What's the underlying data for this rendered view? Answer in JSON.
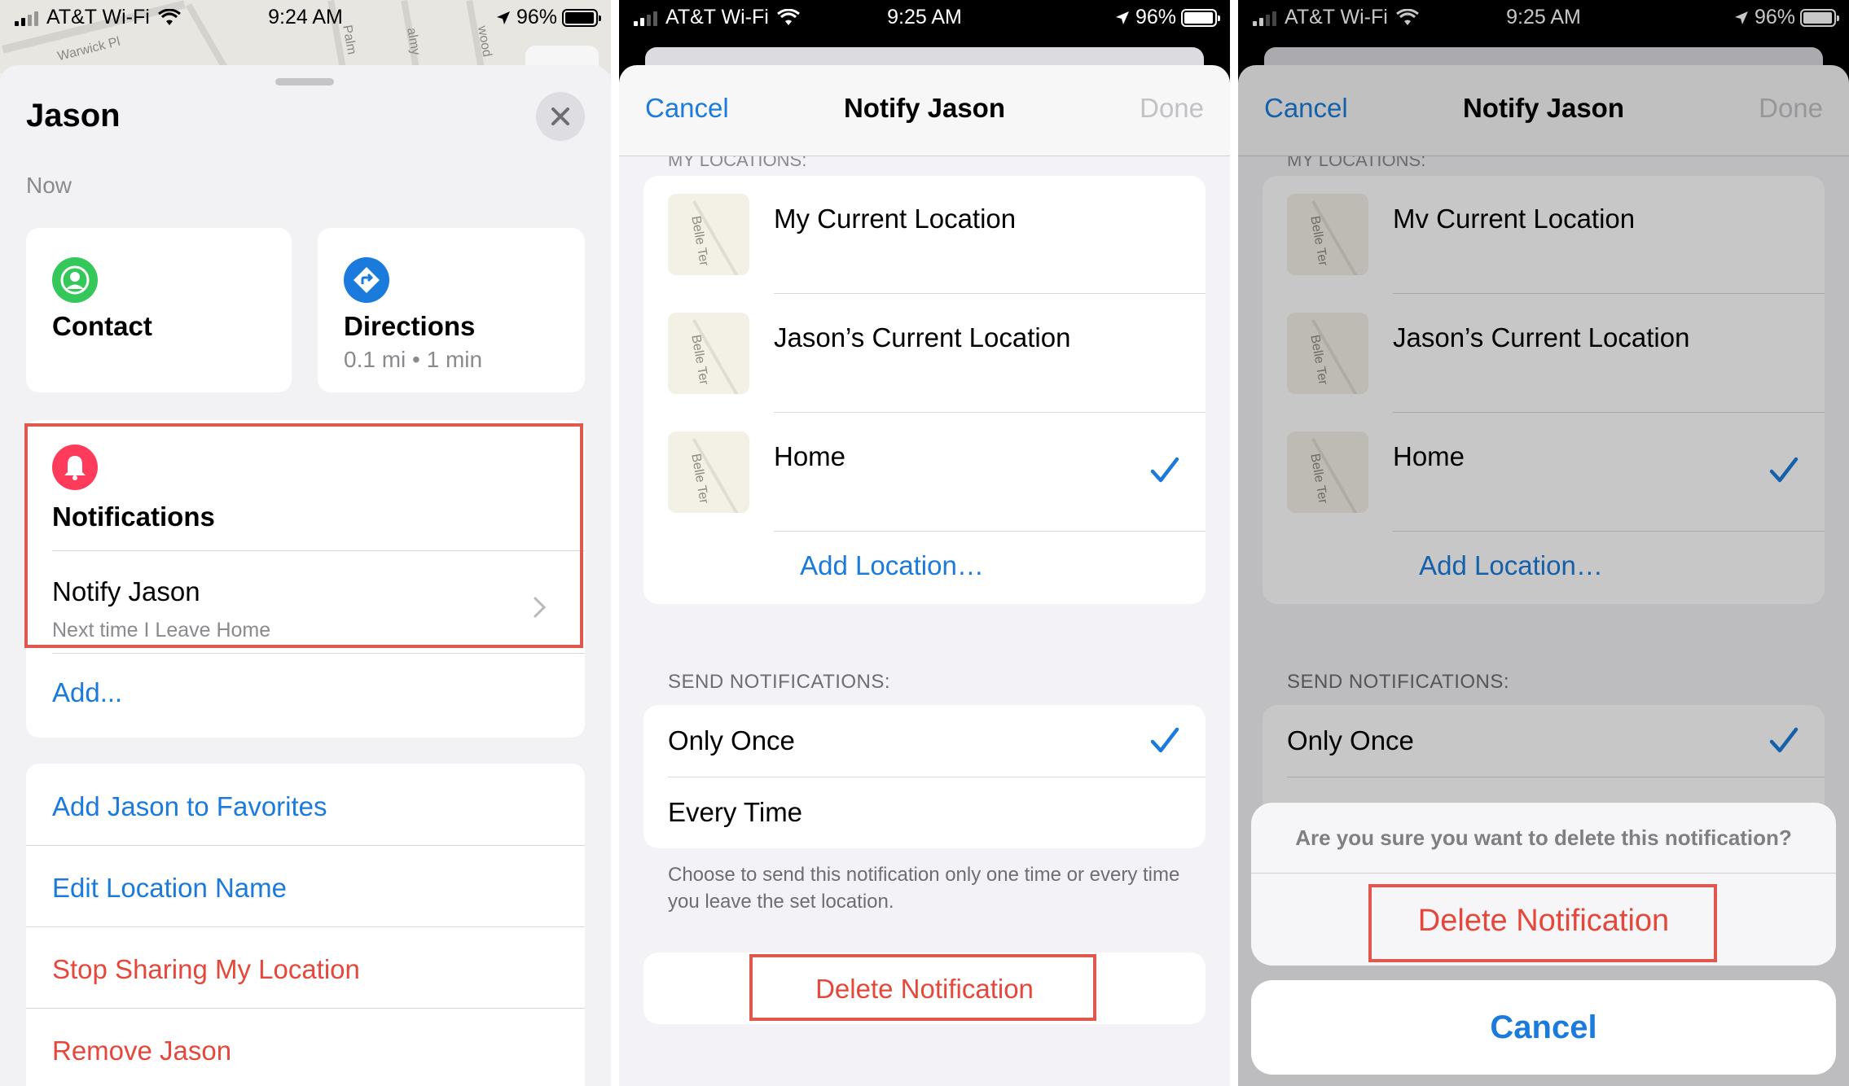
{
  "status_bar": {
    "carrier": "AT&T Wi-Fi",
    "time_panel1": "9:24 AM",
    "time_panel2": "9:25 AM",
    "time_panel3": "9:25 AM",
    "battery": "96%"
  },
  "map_labels": [
    "Warwick Pl",
    "Palm",
    "almy",
    "wood"
  ],
  "person_sheet": {
    "name": "Jason",
    "time": "Now",
    "contact_label": "Contact",
    "directions_label": "Directions",
    "directions_sub": "0.1 mi • 1 min",
    "notifications_label": "Notifications",
    "notify_title": "Notify Jason",
    "notify_sub": "Next time I Leave Home",
    "add_label": "Add...",
    "actions": {
      "favorites": "Add Jason to Favorites",
      "edit_location": "Edit Location Name",
      "stop_sharing": "Stop Sharing My Location",
      "remove": "Remove Jason"
    }
  },
  "notify_screen": {
    "cancel": "Cancel",
    "title": "Notify Jason",
    "done": "Done",
    "locations_header_clipped": "MY LOCATIONS:",
    "thumb_label": "Belle Ter",
    "locations": [
      {
        "name": "My Current Location"
      },
      {
        "name": "Jason’s Current Location"
      },
      {
        "name": "Home",
        "checked": true
      }
    ],
    "add_location": "Add Location…",
    "send_header": "SEND NOTIFICATIONS:",
    "send_options": [
      {
        "label": "Only Once",
        "checked": true
      },
      {
        "label": "Every Time",
        "checked": false
      }
    ],
    "send_footer": "Choose to send this notification only one time or every time you leave the set location.",
    "delete_label": "Delete Notification"
  },
  "confirm_sheet": {
    "location_first": "Mv Current Location",
    "message": "Are you sure you want to delete this notification?",
    "delete_label": "Delete Notification",
    "cancel_label": "Cancel"
  },
  "colors": {
    "accent_blue": "#1a7bdc",
    "destructive_red": "#e5483b",
    "highlight_box": "#e0574e",
    "contact_green": "#34c759",
    "directions_blue": "#1a7bdc",
    "notification_pink": "#ff3b5c"
  }
}
